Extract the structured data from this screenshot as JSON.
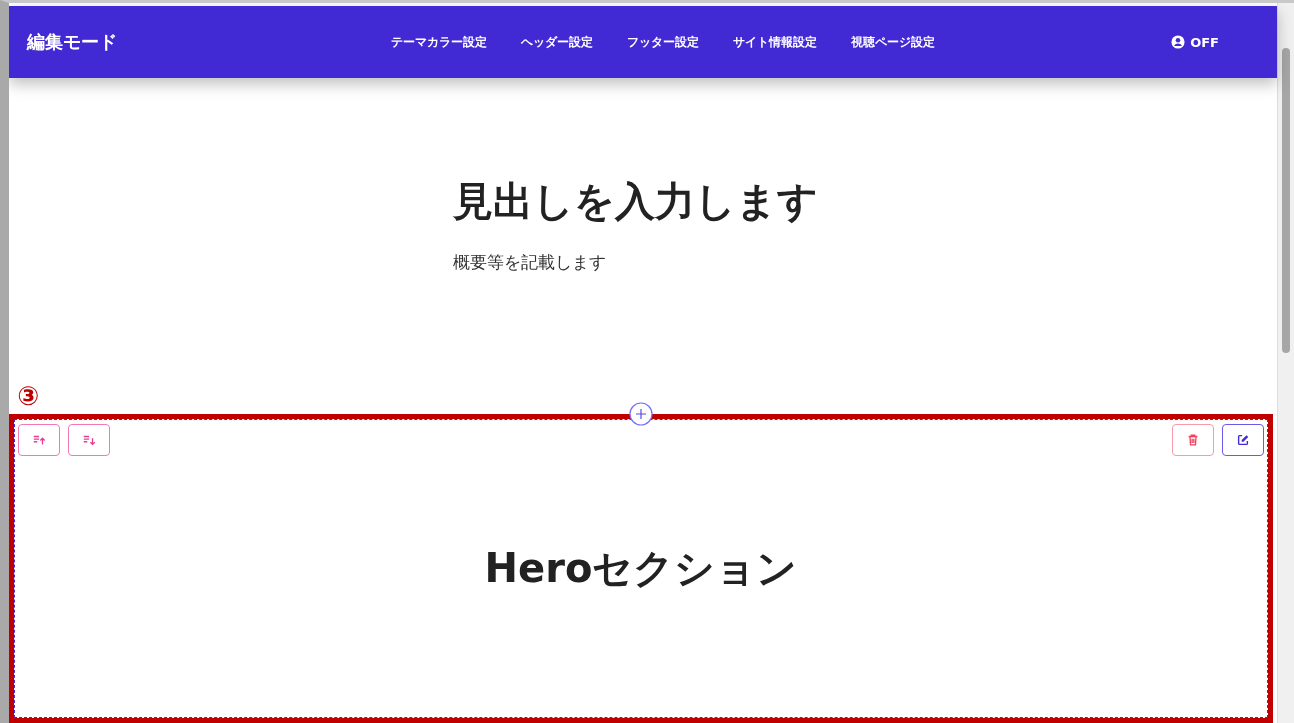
{
  "header": {
    "title": "編集モード",
    "nav": [
      "テーマカラー設定",
      "ヘッダー設定",
      "フッター設定",
      "サイト情報設定",
      "視聴ページ設定"
    ],
    "toggle": {
      "label": "OFF"
    }
  },
  "intro": {
    "heading": "見出しを入力します",
    "summary": "概要等を記載します"
  },
  "annotation": {
    "label": "③"
  },
  "section": {
    "title": "Heroセクション"
  }
}
